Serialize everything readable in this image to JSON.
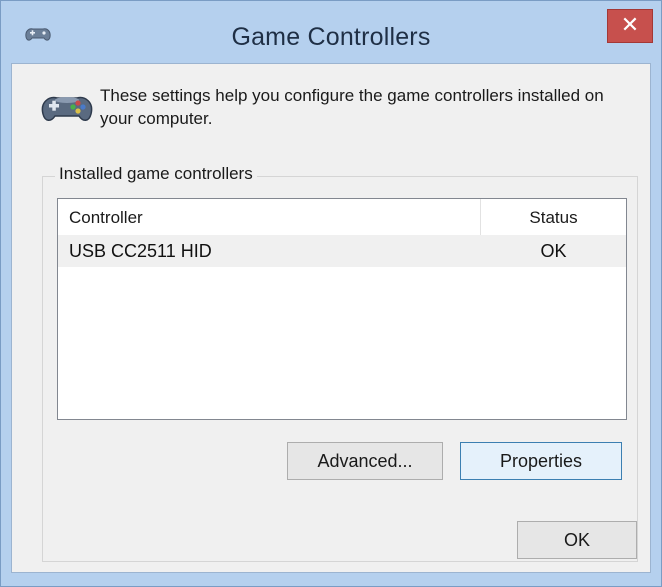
{
  "window": {
    "title": "Game Controllers",
    "close_glyph": "✕",
    "title_icon": "gamepad-icon",
    "accent_color": "#b5d0ee",
    "close_color": "#c7504d"
  },
  "header": {
    "icon": "gamepad-icon",
    "description": "These settings help you configure the game controllers installed on your computer."
  },
  "group": {
    "label": "Installed game controllers"
  },
  "list": {
    "columns": [
      "Controller",
      "Status"
    ],
    "rows": [
      {
        "controller": "USB CC2511 HID",
        "status": "OK"
      }
    ]
  },
  "buttons": {
    "advanced": "Advanced...",
    "properties": "Properties",
    "ok": "OK"
  }
}
